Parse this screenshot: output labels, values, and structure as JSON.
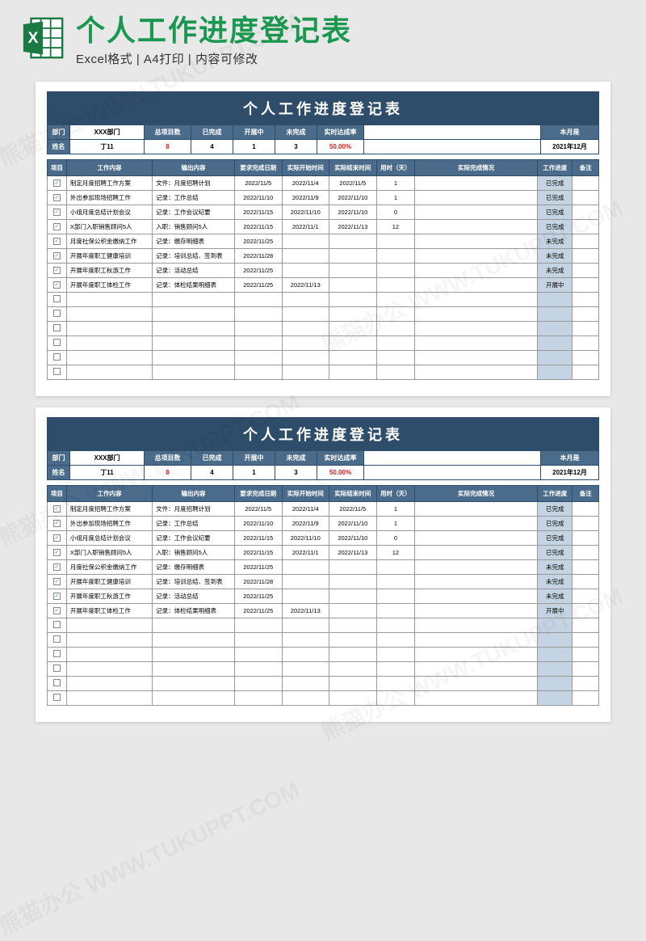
{
  "header": {
    "title": "个人工作进度登记表",
    "subtitle": "Excel格式 | A4打印 | 内容可修改"
  },
  "sheet": {
    "title": "个人工作进度登记表",
    "info": {
      "dept_label": "部门",
      "dept_value": "XXX部门",
      "total_label": "总项目数",
      "total_value": "8",
      "done_label": "已完成",
      "done_value": "4",
      "ongoing_label": "开展中",
      "ongoing_value": "1",
      "undone_label": "未完成",
      "undone_value": "3",
      "rate_label": "实时达成率",
      "rate_value": "50.00%",
      "month_label": "本月是",
      "month_value": "2021年12月",
      "name_label": "姓名",
      "name_value": "丁11"
    },
    "columns": {
      "c0": "项目",
      "c1": "工作内容",
      "c2": "输出内容",
      "c3": "要求完成日期",
      "c4": "实际开始时间",
      "c5": "实际结束时间",
      "c6": "用时（天）",
      "c7": "实际完成情况",
      "c8": "工作进度",
      "c9": "备注"
    },
    "rows": [
      {
        "chk": true,
        "content": "制定月度招聘工作方案",
        "output": "文件：月度招聘计划",
        "due": "2022/11/5",
        "start": "2022/11/4",
        "end": "2022/11/5",
        "days": "1",
        "status": "已完成"
      },
      {
        "chk": true,
        "content": "外出参加现场招聘工作",
        "output": "记录：工作总结",
        "due": "2022/11/10",
        "start": "2022/11/9",
        "end": "2022/11/10",
        "days": "1",
        "status": "已完成"
      },
      {
        "chk": true,
        "content": "小组月度总结计划会议",
        "output": "记录：工作会议纪要",
        "due": "2022/11/15",
        "start": "2022/11/10",
        "end": "2022/11/10",
        "days": "0",
        "status": "已完成"
      },
      {
        "chk": true,
        "content": "X部门入职销售顾问5人",
        "output": "入职：销售顾问5人",
        "due": "2022/11/15",
        "start": "2022/11/1",
        "end": "2022/11/13",
        "days": "12",
        "status": "已完成"
      },
      {
        "chk": true,
        "content": "月度社保公积金缴纳工作",
        "output": "记录：缴存明细表",
        "due": "2022/11/25",
        "start": "",
        "end": "",
        "days": "",
        "status": "未完成"
      },
      {
        "chk": true,
        "content": "开展年度职工健康培训",
        "output": "记录：培训总结、签到表",
        "due": "2022/11/28",
        "start": "",
        "end": "",
        "days": "",
        "status": "未完成"
      },
      {
        "chk": true,
        "content": "开展年度职工秋游工作",
        "output": "记录：活动总结",
        "due": "2022/11/25",
        "start": "",
        "end": "",
        "days": "",
        "status": "未完成"
      },
      {
        "chk": true,
        "content": "开展年度职工体检工作",
        "output": "记录：体检结果明细表",
        "due": "2022/11/25",
        "start": "2022/11/13",
        "end": "",
        "days": "",
        "status": "开展中"
      },
      {
        "chk": false
      },
      {
        "chk": false
      },
      {
        "chk": false
      },
      {
        "chk": false
      },
      {
        "chk": false
      },
      {
        "chk": false
      }
    ]
  },
  "watermark": "熊猫办公 WWW.TUKUPPT.COM"
}
